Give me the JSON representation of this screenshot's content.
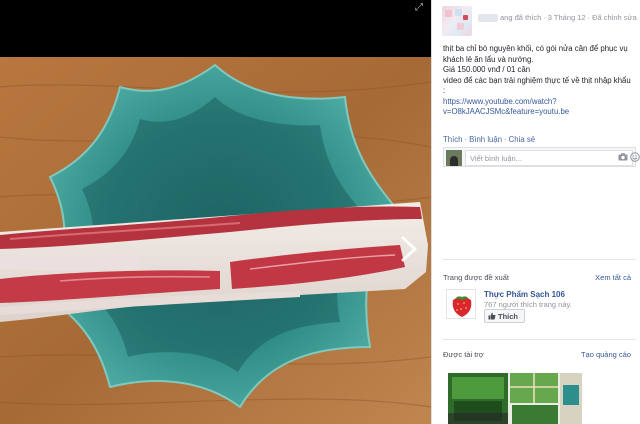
{
  "viewer": {
    "expand_icon": "expand-icon",
    "next_icon": "chevron-right-icon"
  },
  "post": {
    "meta": {
      "action": "ang đã thích",
      "date": "3 Tháng 12",
      "edited": "Đã chỉnh sửa"
    },
    "lines": [
      "thịt ba chỉ bò nguyên khối, có gói nửa cân để phục vụ",
      "khách lẻ ăn lẩu và nướng.",
      "Giá 150.000 vnđ / 01 cân",
      "video để các bạn trải nghiệm thực tế về thịt nhập khẩu",
      ":"
    ],
    "link_lines": [
      "https://www.youtube.com/watch?",
      "v=O8kJAACJSMc&feature=youtu.be"
    ]
  },
  "actions": {
    "like": "Thích",
    "comment": "Bình luận",
    "share": "Chia sẻ"
  },
  "comment": {
    "placeholder": "Viết bình luận...",
    "camera_icon": "camera-icon",
    "emoji_icon": "emoji-icon"
  },
  "suggested": {
    "title": "Trang được đề xuất",
    "see_all": "Xem tất cả",
    "page_name": "Thực Phẩm Sạch 106",
    "page_likes": "767 người thích trang này.",
    "like_button": "Thích"
  },
  "sponsored": {
    "title": "Được tài trợ",
    "create_ad": "Tạo quảng cáo"
  },
  "colors": {
    "link": "#365899",
    "muted": "#90949c",
    "text": "#1d2129",
    "viewer_bg": "#000000"
  }
}
